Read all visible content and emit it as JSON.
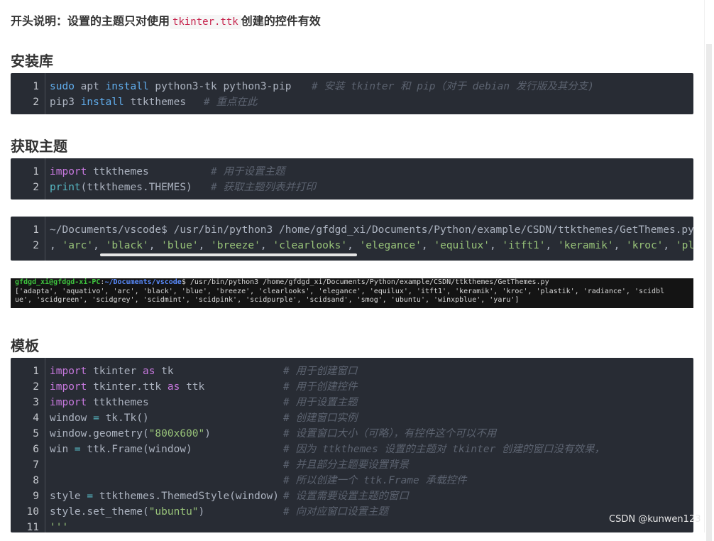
{
  "intro": {
    "prefix": "开头说明：设置的主题只对使用",
    "code": "tkinter.ttk",
    "suffix": "创建的控件有效"
  },
  "sections": {
    "install": "安装库",
    "get_themes": "获取主题",
    "template": "模板"
  },
  "install_code": {
    "line1_code": [
      "sudo",
      " apt ",
      "install",
      " python3-tk python3-pip"
    ],
    "line1_comment": "# 安装 tkinter 和 pip（对于 debian 发行版及其分支)",
    "line2_code": [
      "pip3 ",
      "install",
      " ttkthemes"
    ],
    "line2_comment": "# 重点在此"
  },
  "get_code": {
    "line1": [
      "import",
      " ttkthemes"
    ],
    "line1_comment": "# 用于设置主题",
    "line2": [
      "print",
      "(ttkthemes.THEMES)"
    ],
    "line2_comment": "# 获取主题列表并打印"
  },
  "output_code": {
    "line1": "~/Documents/vscode$ /usr/bin/python3 /home/gfdgd_xi/Documents/Python/example/CSDN/ttkthemes/GetThemes.py",
    "themes": [
      "arc",
      "black",
      "blue",
      "breeze",
      "clearlooks",
      "elegance",
      "equilux",
      "itft1",
      "keramik",
      "kroc",
      "plas"
    ]
  },
  "terminal": {
    "user": "gfdgd_xi@gfdgd-xi-PC",
    "path": "~/Documents/vscode",
    "cmd": "$ /usr/bin/python3 /home/gfdgd_xi/Documents/Python/example/CSDN/ttkthemes/GetThemes.py",
    "out1": "['adapta', 'aquativo', 'arc', 'black', 'blue', 'breeze', 'clearlooks', 'elegance', 'equilux', 'itft1', 'keramik', 'kroc', 'plastik', 'radiance', 'scidbl",
    "out2": "ue', 'scidgreen', 'scidgrey', 'scidmint', 'scidpink', 'scidpurple', 'scidsand', 'smog', 'ubuntu', 'winxpblue', 'yaru']"
  },
  "template_code": {
    "comments": [
      "# 用于创建窗口",
      "# 用于创建控件",
      "# 用于设置主题",
      "# 创建窗口实例",
      "# 设置窗口大小（可略），有控件这个可以不用",
      "# 因为 ttkthemes 设置的主题对 tkinter 创建的窗口没有效果，",
      "# 并且部分主题要设置背景",
      "# 所以创建一个 ttk.Frame 承载控件",
      "# 设置需要设置主题的窗口",
      "# 向对应窗口设置主题",
      ""
    ],
    "l1": [
      "import",
      " tkinter ",
      "as",
      " tk"
    ],
    "l2": [
      "import",
      " tkinter.ttk ",
      "as",
      " ttk"
    ],
    "l3": [
      "import",
      " ttkthemes"
    ],
    "l4": [
      "window ",
      "=",
      " tk.Tk()"
    ],
    "l5": [
      "window.geometry(",
      "\"800x600\"",
      ")"
    ],
    "l6": [
      "win ",
      "=",
      " ttk.Frame(window)"
    ],
    "l9": [
      "style ",
      "=",
      " ttkthemes.ThemedStyle(window)"
    ],
    "l10": [
      "style.set_theme(",
      "\"ubuntu\"",
      ")"
    ],
    "l11": "'''"
  },
  "line_numbers": [
    "1",
    "2",
    "3",
    "4",
    "5",
    "6",
    "7",
    "8",
    "9",
    "10",
    "11"
  ],
  "watermark": "CSDN @kunwen123"
}
